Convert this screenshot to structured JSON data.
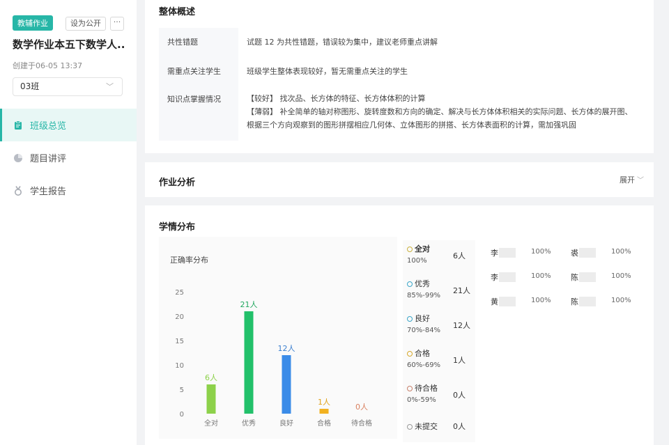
{
  "sidebar": {
    "tag": "教辅作业",
    "public_button": "设为公开",
    "more_button": "···",
    "homework_title": "数学作业本五下数学人...",
    "created": "创建于06-05 13:37",
    "class_select": "03班",
    "nav": [
      {
        "label": "班级总览",
        "icon": "clipboard-icon",
        "active": true
      },
      {
        "label": "题目讲评",
        "icon": "pie-chart-icon",
        "active": false
      },
      {
        "label": "学生报告",
        "icon": "medal-icon",
        "active": false
      }
    ]
  },
  "overview": {
    "title": "整体概述",
    "rows": [
      {
        "label": "共性错题",
        "lines": [
          "试题 12 为共性错题，错误较为集中，建议老师重点讲解"
        ]
      },
      {
        "label": "需重点关注学生",
        "lines": [
          "班级学生整体表现较好，暂无需重点关注的学生"
        ]
      },
      {
        "label": "知识点掌握情况",
        "lines": [
          "【较好】 找次品、长方体的特征、长方体体积的计算",
          "【薄弱】 补全简单的轴对称图形、旋转度数和方向的确定、解决与长方体体积相关的实际问题、长方体的展开图、",
          "根据三个方向观察到的图形拼摆相应几何体、立体图形的拼搭、长方体表面积的计算，需加强巩固"
        ]
      }
    ]
  },
  "analysis": {
    "title": "作业分析",
    "expand_label": "展开"
  },
  "distribution": {
    "title": "学情分布",
    "legend": [
      {
        "name": "全对",
        "range": "100%",
        "count": "6人",
        "color": "#c9b03c"
      },
      {
        "name": "优秀",
        "range": "85%-99%",
        "count": "21人",
        "color": "#3aa6c8"
      },
      {
        "name": "良好",
        "range": "70%-84%",
        "count": "12人",
        "color": "#3aa6c8"
      },
      {
        "name": "合格",
        "range": "60%-69%",
        "count": "1人",
        "color": "#d6a82a"
      },
      {
        "name": "待合格",
        "range": "0%-59%",
        "count": "0人",
        "color": "#c7806a"
      },
      {
        "name": "未提交",
        "range": "",
        "count": "0人",
        "color": "#999999"
      }
    ],
    "students": [
      {
        "name": "李",
        "score": "100%"
      },
      {
        "name": "裘",
        "score": "100%"
      },
      {
        "name": "李",
        "score": "100%"
      },
      {
        "name": "陈",
        "score": "100%"
      },
      {
        "name": "黄",
        "score": "100%"
      },
      {
        "name": "陈",
        "score": "100%"
      }
    ]
  },
  "chart_data": {
    "type": "bar",
    "title": "正确率分布",
    "categories": [
      "全对",
      "优秀",
      "良好",
      "合格",
      "待合格"
    ],
    "values": [
      6,
      21,
      12,
      1,
      0
    ],
    "data_labels": [
      "6人",
      "21人",
      "12人",
      "1人",
      "0人"
    ],
    "colors": [
      "#8dd14a",
      "#22c06a",
      "#3b8ce8",
      "#f2b221",
      "#e07a5f"
    ],
    "label_colors": [
      "#8dd14a",
      "#22a860",
      "#3b7fcf",
      "#e0a21a",
      "#d9805f"
    ],
    "yticks": [
      0,
      5,
      10,
      15,
      20,
      25
    ],
    "ylim": [
      0,
      25
    ],
    "grid": false
  }
}
